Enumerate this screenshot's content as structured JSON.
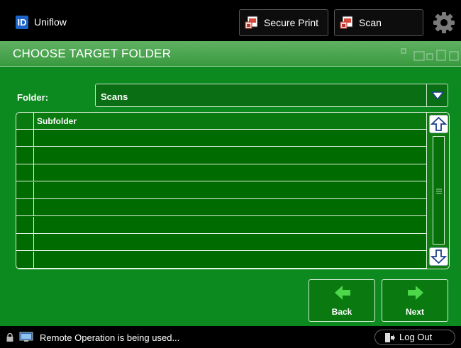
{
  "header": {
    "logo_text": "ID",
    "app_name": "Uniflow",
    "secure_print_label": "Secure Print",
    "scan_label": "Scan",
    "settings_icon": "gear-icon"
  },
  "page": {
    "title": "CHOOSE TARGET FOLDER"
  },
  "folder": {
    "label": "Folder:",
    "value": "Scans"
  },
  "table": {
    "column_header": "Subfolder",
    "rows": [
      "",
      "",
      "",
      "",
      "",
      "",
      "",
      ""
    ]
  },
  "buttons": {
    "back_label": "Back",
    "next_label": "Next"
  },
  "status": {
    "message": "Remote Operation is being used...",
    "logout_label": "Log Out"
  },
  "colors": {
    "panel_green": "#0d8a1f",
    "title_green": "#4ea851",
    "arrow_green": "#4cd84a",
    "scroll_arrow_blue": "#1d3f8a"
  }
}
